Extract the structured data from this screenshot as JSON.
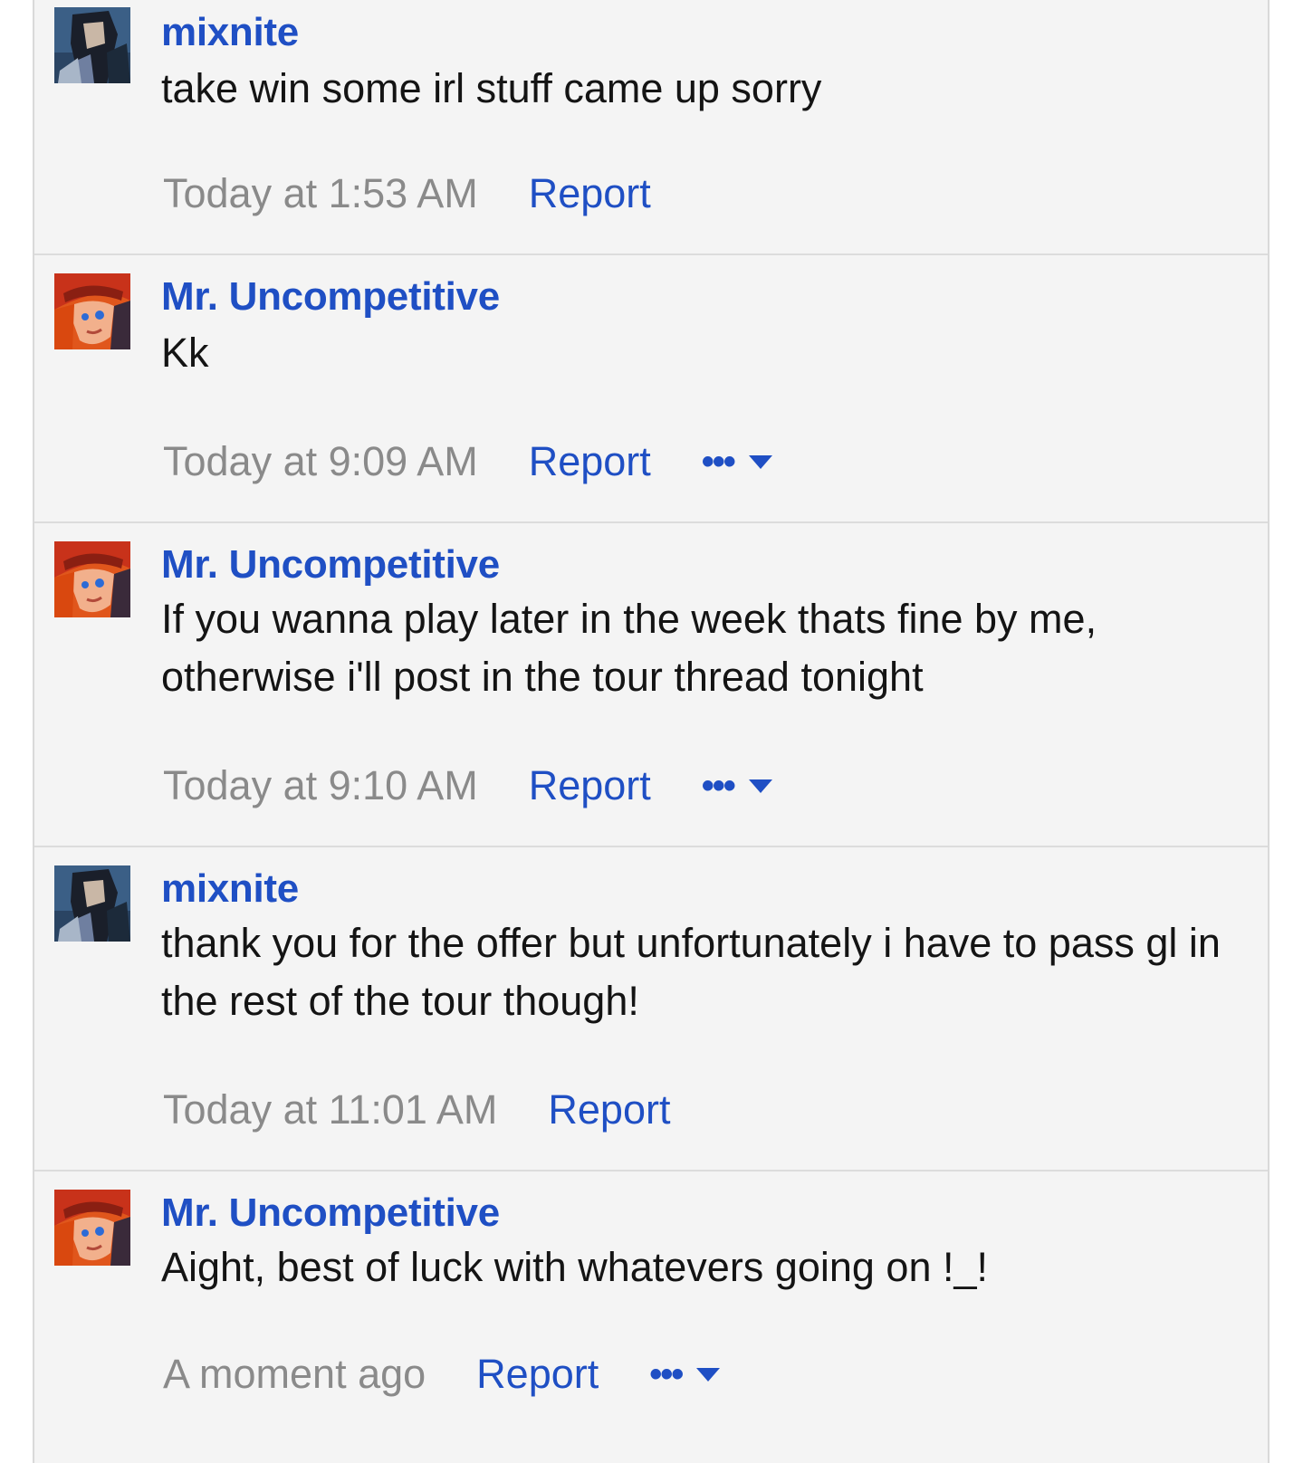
{
  "messages": [
    {
      "author": "mixnite",
      "avatar_icon": "mixnite-avatar-icon",
      "text": "take win some irl stuff came up sorry",
      "time": "Today at 1:53 AM",
      "report_label": "Report",
      "has_more": false
    },
    {
      "author": "Mr. Uncompetitive",
      "avatar_icon": "mr-uncompetitive-avatar-icon",
      "text": "Kk",
      "time": "Today at 9:09 AM",
      "report_label": "Report",
      "has_more": true,
      "more_label": "•••"
    },
    {
      "author": "Mr. Uncompetitive",
      "avatar_icon": "mr-uncompetitive-avatar-icon",
      "text": "If you wanna play later in the week thats fine by me, otherwise i'll post in the tour thread tonight",
      "time": "Today at 9:10 AM",
      "report_label": "Report",
      "has_more": true,
      "more_label": "•••"
    },
    {
      "author": "mixnite",
      "avatar_icon": "mixnite-avatar-icon",
      "text": "thank you for the offer but unfortunately i have to pass gl in the rest of the tour though!",
      "time": "Today at 11:01 AM",
      "report_label": "Report",
      "has_more": false
    },
    {
      "author": "Mr. Uncompetitive",
      "avatar_icon": "mr-uncompetitive-avatar-icon",
      "text": "Aight, best of luck with whatevers going on !_!",
      "time": "A moment ago",
      "report_label": "Report",
      "has_more": true,
      "more_label": "•••"
    }
  ],
  "colors": {
    "link": "#1f4fc4",
    "timestamp": "#8a8a8a",
    "background": "#f4f4f4",
    "text": "#141414"
  }
}
